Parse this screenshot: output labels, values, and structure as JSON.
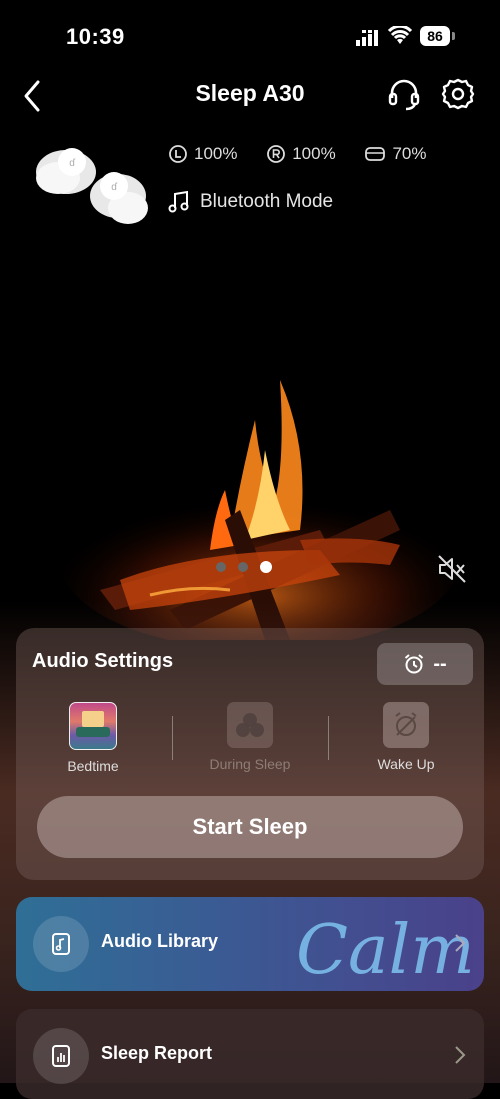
{
  "status": {
    "time": "10:39",
    "battery": "86"
  },
  "nav": {
    "title": "Sleep A30"
  },
  "device": {
    "left_battery": "100%",
    "right_battery": "100%",
    "case_battery": "70%",
    "mode": "Bluetooth Mode"
  },
  "carousel": {
    "pages": 3,
    "active": 3
  },
  "audio_settings": {
    "title": "Audio Settings",
    "timer_value": "--",
    "modes": [
      {
        "label": "Bedtime",
        "enabled": true
      },
      {
        "label": "During Sleep",
        "enabled": false
      },
      {
        "label": "Wake Up",
        "enabled": true
      }
    ],
    "start_label": "Start Sleep"
  },
  "cards": {
    "library_label": "Audio Library",
    "library_brand": "Calm",
    "report_label": "Sleep Report"
  },
  "colors": {
    "background": "#000000",
    "panel": "#7a5f5a",
    "library_start": "#2f6f96",
    "library_end": "#4a418a"
  },
  "icons": [
    "back-icon",
    "headset-icon",
    "settings-gear-icon",
    "clock-icon",
    "r-icon",
    "case-icon",
    "music-note-icon",
    "mute-icon",
    "alarm-clock-icon",
    "music-file-icon",
    "report-icon",
    "chevron-right-icon"
  ]
}
